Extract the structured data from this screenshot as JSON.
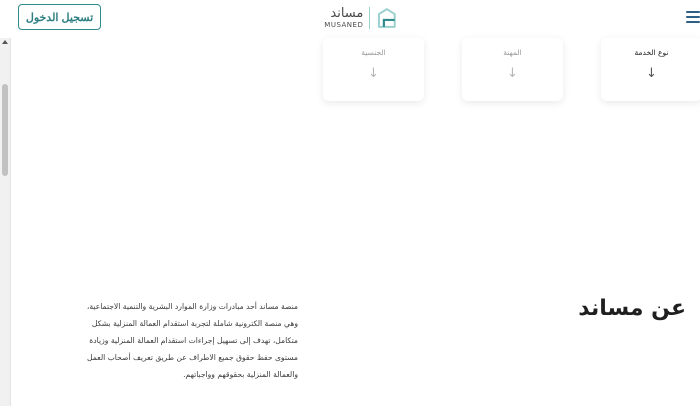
{
  "header": {
    "login_label": "تسجيل الدخول",
    "logo_ar": "مساند",
    "logo_en": "MUSANED",
    "brand_color": "#2f8b8b"
  },
  "filters": [
    {
      "label": "نوع الخدمة",
      "icon": "arrow-down-icon"
    },
    {
      "label": "المهنة",
      "icon": "arrow-down-icon"
    },
    {
      "label": "الجنسية",
      "icon": "arrow-down-icon"
    }
  ],
  "about": {
    "title": "عن مساند",
    "lines": [
      "منصة مساند أحد مبادرات وزارة الموارد البشرية والتنمية الاجتماعية،",
      "وهي منصة الكترونية شاملة لتجربة استقدام العمالة المنزلية بشكل",
      "متكامل، تهدف إلى تسهيل إجراءات استقدام العمالة المنزلية وزيادة",
      "مستوى حفظ حقوق جميع الاطراف عن طريق تعريف أصحاب العمل",
      "والعمالة المنزلية بحقوقهم وواجباتهم."
    ]
  }
}
